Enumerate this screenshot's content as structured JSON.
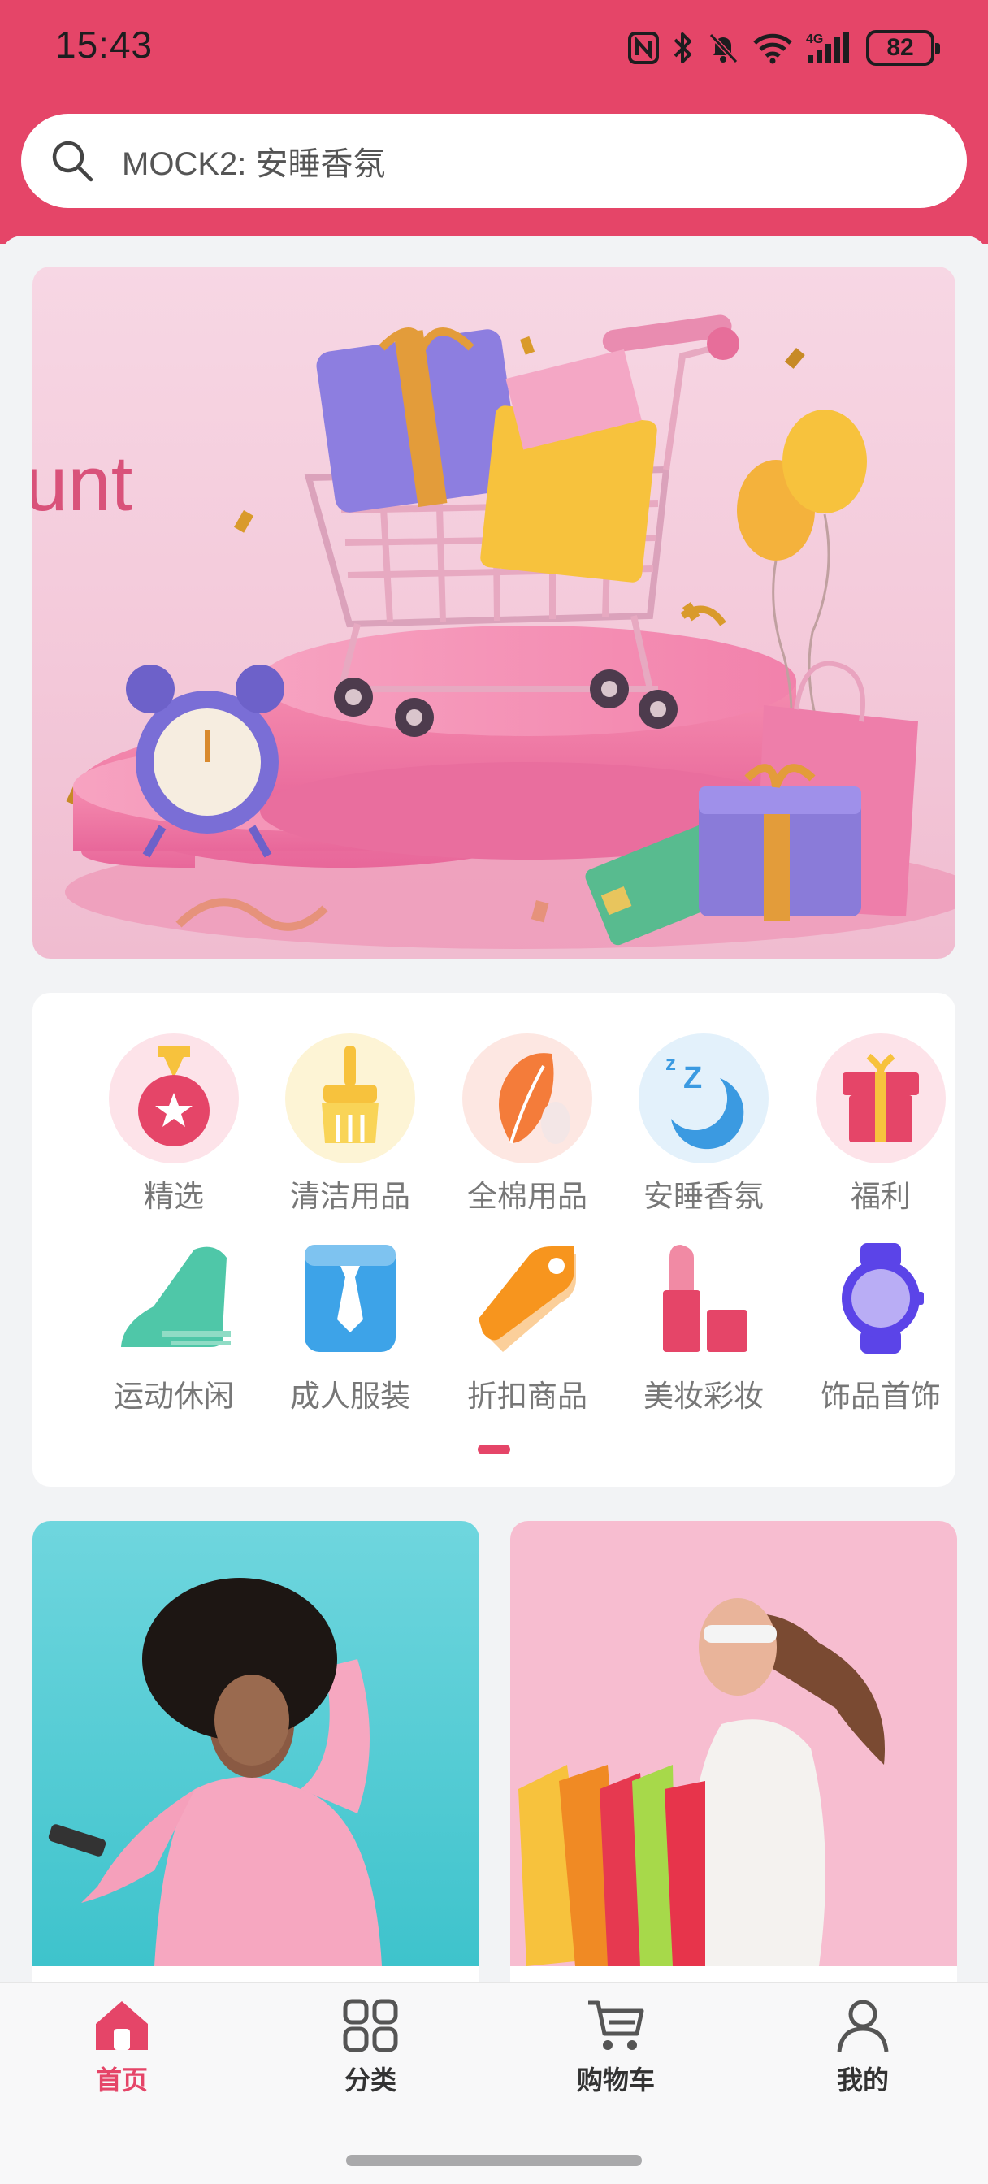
{
  "status_bar": {
    "time": "15:43",
    "battery": "82"
  },
  "search": {
    "text": "MOCK2: 安睡香氛"
  },
  "banner": {
    "visible_text": "unt"
  },
  "categories": [
    {
      "label": "精选",
      "icon": "medal-star-icon"
    },
    {
      "label": "清洁用品",
      "icon": "broom-icon"
    },
    {
      "label": "全棉用品",
      "icon": "cotton-leaf-icon"
    },
    {
      "label": "安睡香氛",
      "icon": "moon-sleep-icon"
    },
    {
      "label": "福利",
      "icon": "gift-icon"
    },
    {
      "label": "运动休闲",
      "icon": "sneaker-icon"
    },
    {
      "label": "成人服装",
      "icon": "shirt-tie-icon"
    },
    {
      "label": "折扣商品",
      "icon": "price-tag-icon"
    },
    {
      "label": "美妆彩妆",
      "icon": "lipstick-icon"
    },
    {
      "label": "饰品首饰",
      "icon": "watch-icon"
    }
  ],
  "tabbar": {
    "items": [
      {
        "label": "首页",
        "icon": "home-icon",
        "active": true
      },
      {
        "label": "分类",
        "icon": "grid-icon",
        "active": false
      },
      {
        "label": "购物车",
        "icon": "cart-icon",
        "active": false
      },
      {
        "label": "我的",
        "icon": "user-icon",
        "active": false
      }
    ]
  },
  "colors": {
    "brand": "#e54568",
    "background": "#f2f3f5",
    "label": "#777777"
  }
}
